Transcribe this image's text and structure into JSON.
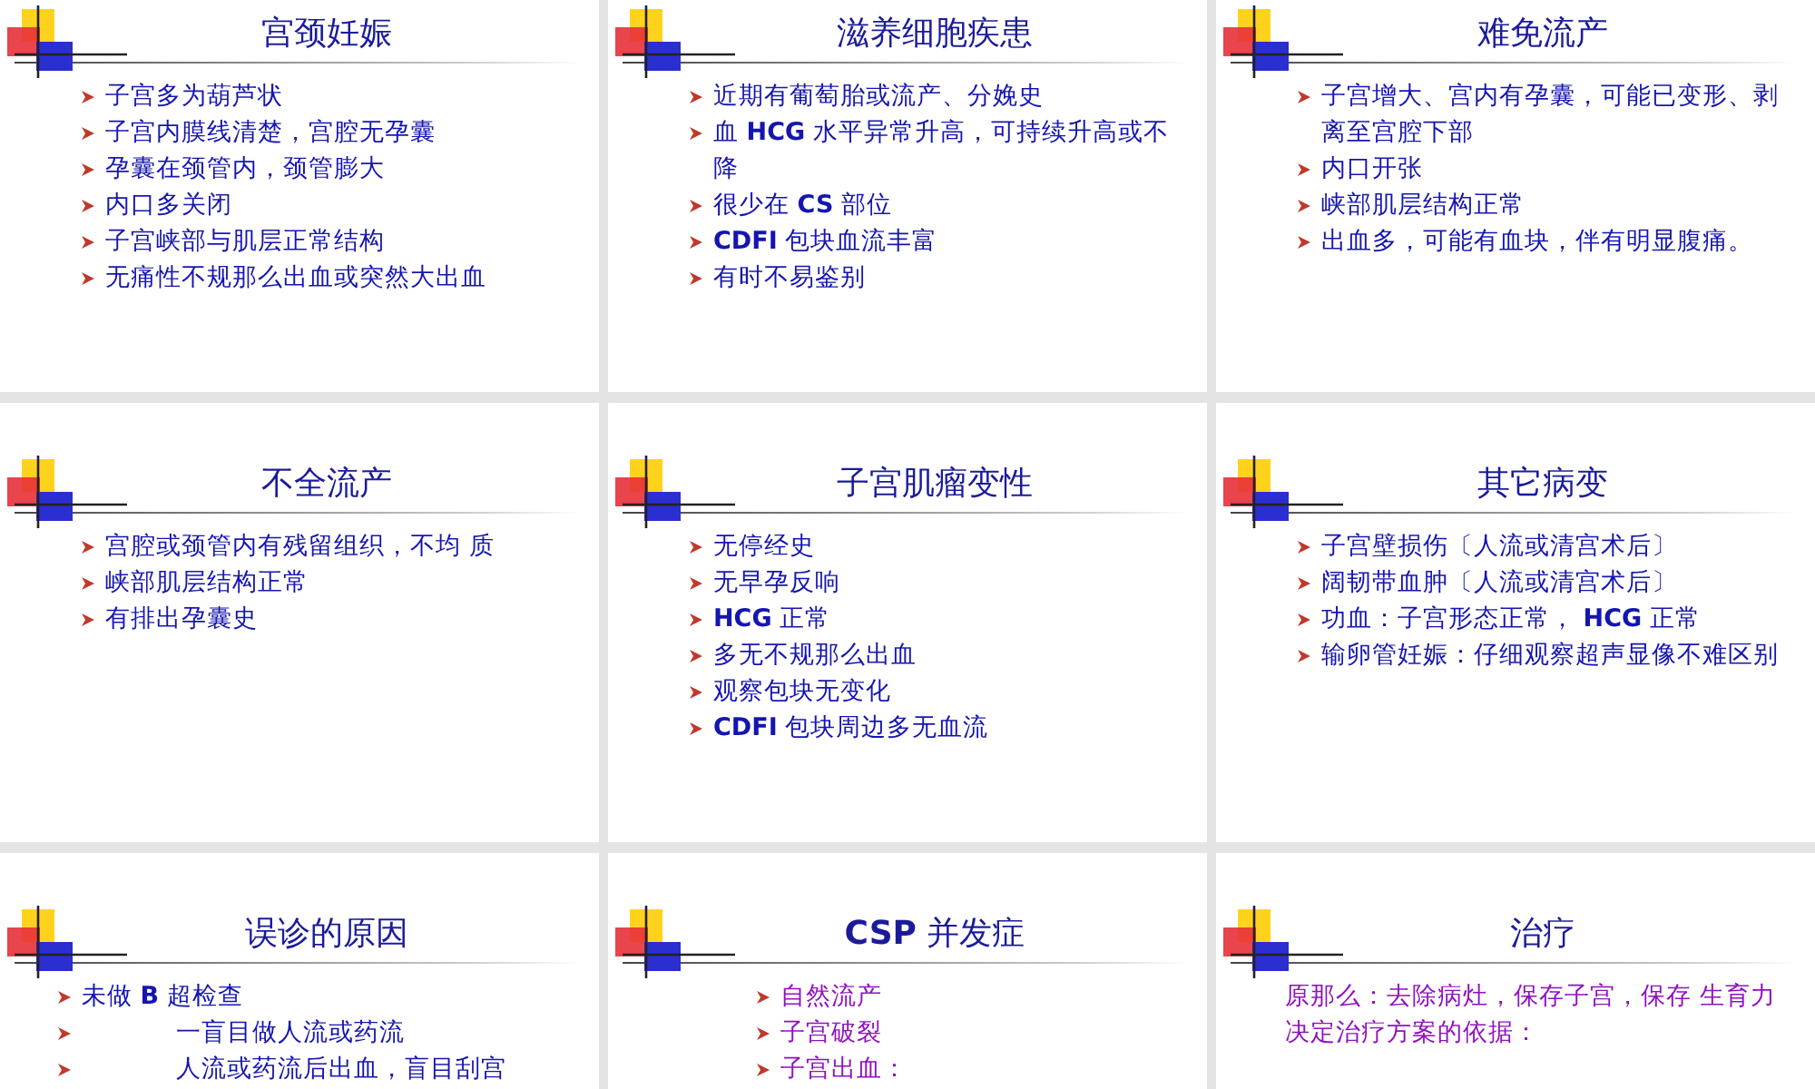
{
  "slides": [
    {
      "title": "宫颈妊娠",
      "color": "#1515b0",
      "items": [
        {
          "kind": "bullet",
          "text": "子宫多为葫芦状"
        },
        {
          "kind": "bullet",
          "text": "子宫内膜线清楚，宫腔无孕囊"
        },
        {
          "kind": "bullet",
          "text": "孕囊在颈管内，颈管膨大"
        },
        {
          "kind": "bullet",
          "text": "内口多关闭"
        },
        {
          "kind": "bullet",
          "text": "子宫峡部与肌层正常结构"
        },
        {
          "kind": "bullet",
          "text": "无痛性不规那么出血或突然大出血"
        }
      ]
    },
    {
      "title": "滋养细胞疾患",
      "color": "#1515b0",
      "items": [
        {
          "kind": "bullet",
          "text": "近期有葡萄胎或流产、分娩史"
        },
        {
          "kind": "bullet",
          "text": "血 **HCG** 水平异常升高，可持续升高或不降"
        },
        {
          "kind": "bullet",
          "text": "很少在 **CS** 部位"
        },
        {
          "kind": "bullet",
          "text": "**CDFI** 包块血流丰富"
        },
        {
          "kind": "bullet",
          "text": "有时不易鉴别"
        }
      ]
    },
    {
      "title": "难免流产",
      "color": "#1515b0",
      "items": [
        {
          "kind": "bullet",
          "text": "子宫增大、宫内有孕囊，可能已变形、剥离至宫腔下部"
        },
        {
          "kind": "bullet",
          "text": "内口开张"
        },
        {
          "kind": "bullet",
          "text": "峡部肌层结构正常"
        },
        {
          "kind": "bullet",
          "text": "出血多，可能有血块，伴有明显腹痛。"
        }
      ]
    },
    {
      "title": "不全流产",
      "color": "#1515b0",
      "items": [
        {
          "kind": "bullet",
          "text": "宫腔或颈管内有残留组织，不均  质"
        },
        {
          "kind": "bullet",
          "text": "峡部肌层结构正常"
        },
        {
          "kind": "bullet",
          "text": "有排出孕囊史"
        }
      ]
    },
    {
      "title": "子宫肌瘤变性",
      "color": "#1515b0",
      "items": [
        {
          "kind": "bullet",
          "text": "无停经史"
        },
        {
          "kind": "bullet",
          "text": "无早孕反响"
        },
        {
          "kind": "bullet",
          "text": "**HCG** 正常"
        },
        {
          "kind": "bullet",
          "text": "多无不规那么出血"
        },
        {
          "kind": "bullet",
          "text": "观察包块无变化"
        },
        {
          "kind": "bullet",
          "text": "**CDFI** 包块周边多无血流"
        }
      ]
    },
    {
      "title": "其它病变",
      "color": "#1515b0",
      "items": [
        {
          "kind": "bullet",
          "text": "子宫壁损伤〔人流或清宫术后〕"
        },
        {
          "kind": "bullet",
          "text": "阔韧带血肿〔人流或清宫术后〕"
        },
        {
          "kind": "bullet",
          "text": "功血：子宫形态正常，    **HCG** 正常"
        },
        {
          "kind": "bullet",
          "text": "输卵管妊娠：仔细观察超声显像不难区别"
        }
      ]
    },
    {
      "title": "误诊的原因",
      "color": "#1515b0",
      "items": [
        {
          "kind": "bullet",
          "text": "未做 **B** 超检查"
        },
        {
          "kind": "spaced",
          "text": "一盲目做人流或药流"
        },
        {
          "kind": "spaced",
          "text": "人流或药流后出血，盲目刮宫"
        }
      ]
    },
    {
      "title": "**CSP** 并发症",
      "color": "#9010c0",
      "items": [
        {
          "kind": "bullet",
          "text": "自然流产"
        },
        {
          "kind": "bullet",
          "text": "子宫破裂"
        },
        {
          "kind": "bullet",
          "text": "子宫出血："
        }
      ]
    },
    {
      "title": "治疗",
      "color": "#9010c0",
      "items": [
        {
          "kind": "plain",
          "text": "原那么：去除病灶，保存子宫，保存  生育力"
        },
        {
          "kind": "plain",
          "text": "决定治疗方案的依据："
        }
      ]
    }
  ]
}
